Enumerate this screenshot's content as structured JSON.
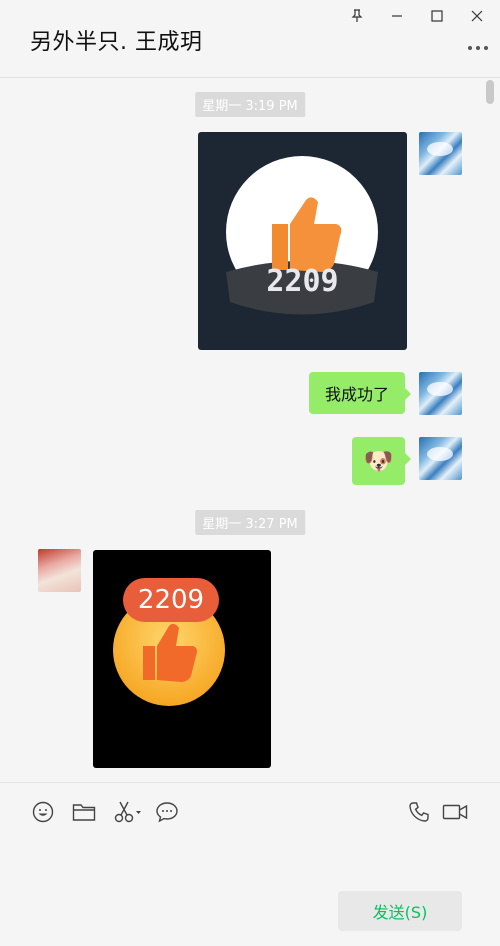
{
  "window": {
    "title": "另外半只. 王成玥"
  },
  "messages": [
    {
      "type": "timestamp",
      "text": "星期一 3:19 PM"
    },
    {
      "type": "image",
      "sender": "self",
      "badge_number": "2209",
      "description": "thumbs-up badge"
    },
    {
      "type": "text",
      "sender": "self",
      "text": "我成功了"
    },
    {
      "type": "emoji",
      "sender": "self",
      "emoji": "🐶"
    },
    {
      "type": "timestamp",
      "text": "星期一 3:27 PM"
    },
    {
      "type": "image",
      "sender": "other",
      "badge_number": "2209",
      "description": "thumbs-up badge"
    }
  ],
  "toolbar": {
    "icons": [
      "emoji-icon",
      "folder-icon",
      "scissors-icon",
      "chat-icon",
      "phone-icon",
      "video-icon"
    ],
    "send_label": "发送(S)"
  },
  "colors": {
    "bubble_self": "#95ec69",
    "send_text": "#07c160",
    "background": "#f5f5f5"
  }
}
